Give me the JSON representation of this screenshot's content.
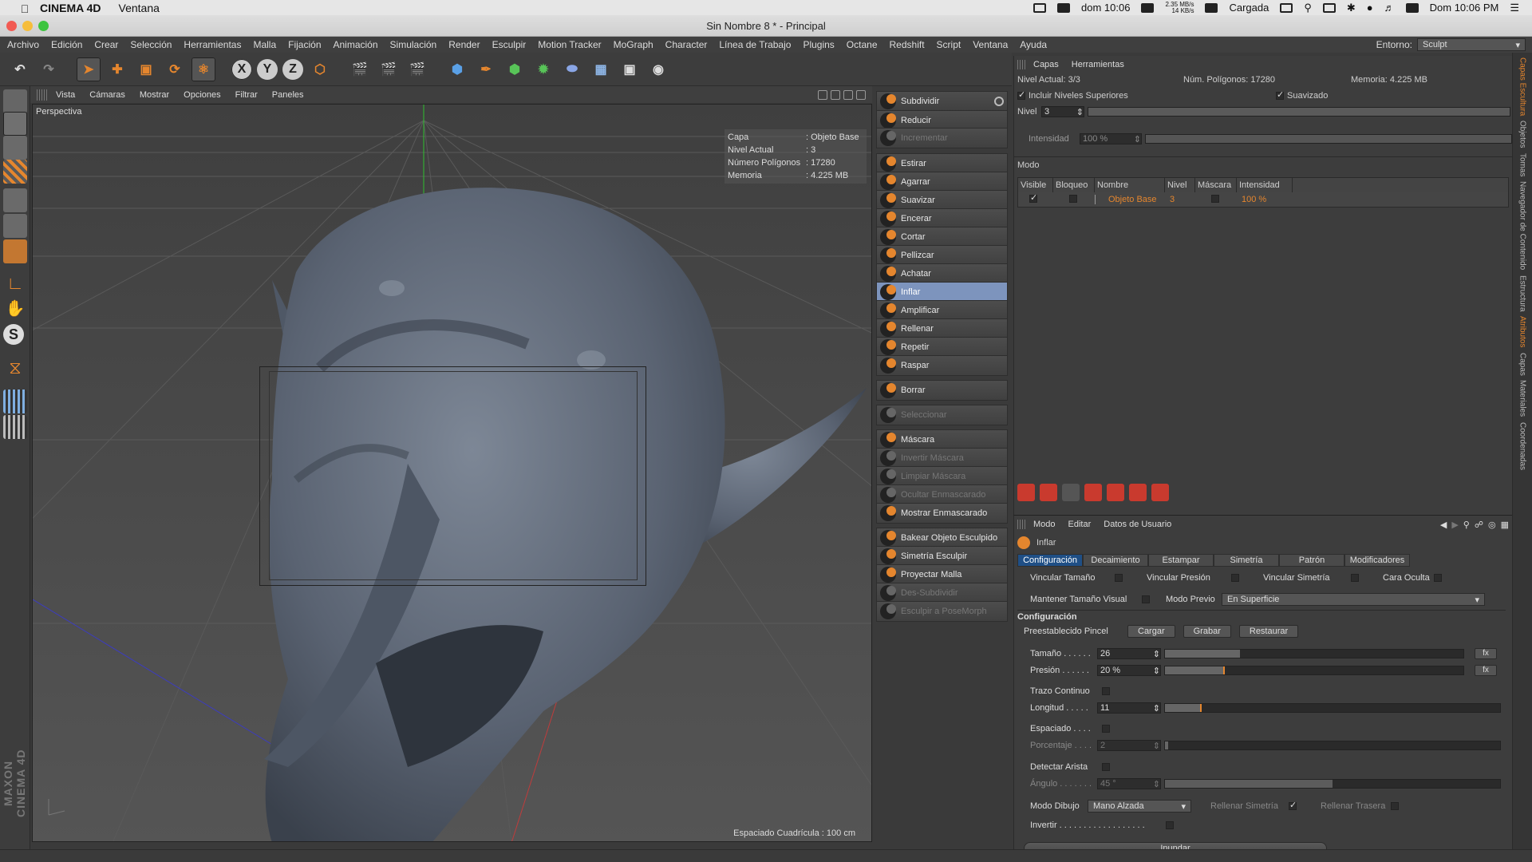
{
  "mac_menubar": {
    "app_name": "CINEMA 4D",
    "menu": "Ventana",
    "clock1": "dom 10:06",
    "net_up": "2.35 MB/s",
    "net_down": "14 KB/s",
    "battery": "Cargada",
    "clock2": "Dom 10:06 PM"
  },
  "window": {
    "title": "Sin Nombre 8 * - Principal"
  },
  "menubar": {
    "items": [
      "Archivo",
      "Edición",
      "Crear",
      "Selección",
      "Herramientas",
      "Malla",
      "Fijación",
      "Animación",
      "Simulación",
      "Render",
      "Esculpir",
      "Motion Tracker",
      "MoGraph",
      "Character",
      "Línea de Trabajo",
      "Plugins",
      "Octane",
      "Redshift",
      "Script",
      "Ventana",
      "Ayuda"
    ],
    "env_label": "Entorno:",
    "env_value": "Sculpt"
  },
  "viewport_menu": {
    "items": [
      "Vista",
      "Cámaras",
      "Mostrar",
      "Opciones",
      "Filtrar",
      "Paneles"
    ]
  },
  "viewport": {
    "label": "Perspectiva",
    "hud": [
      {
        "k": "Capa",
        "v": ": Objeto Base"
      },
      {
        "k": "Nivel Actual",
        "v": ": 3"
      },
      {
        "k": "Número Polígonos",
        "v": ": 17280"
      },
      {
        "k": "Memoria",
        "v": ": 4.225 MB"
      }
    ],
    "grid_spacing": "Espaciado Cuadrícula : 100 cm"
  },
  "sculpt_tools": [
    {
      "label": "Subdividir",
      "state": "normal"
    },
    {
      "label": "Reducir",
      "state": "normal"
    },
    {
      "label": "Incrementar",
      "state": "disabled"
    },
    {
      "label": "Estirar",
      "state": "normal"
    },
    {
      "label": "Agarrar",
      "state": "normal"
    },
    {
      "label": "Suavizar",
      "state": "normal"
    },
    {
      "label": "Encerar",
      "state": "normal"
    },
    {
      "label": "Cortar",
      "state": "normal"
    },
    {
      "label": "Pellizcar",
      "state": "normal"
    },
    {
      "label": "Achatar",
      "state": "normal"
    },
    {
      "label": "Inflar",
      "state": "active"
    },
    {
      "label": "Amplificar",
      "state": "normal"
    },
    {
      "label": "Rellenar",
      "state": "normal"
    },
    {
      "label": "Repetir",
      "state": "normal"
    },
    {
      "label": "Raspar",
      "state": "normal"
    },
    {
      "label": "Borrar",
      "state": "normal"
    },
    {
      "label": "Seleccionar",
      "state": "disabled"
    },
    {
      "label": "Máscara",
      "state": "normal"
    },
    {
      "label": "Invertir Máscara",
      "state": "disabled"
    },
    {
      "label": "Limpiar Máscara",
      "state": "disabled"
    },
    {
      "label": "Ocultar Enmascarado",
      "state": "disabled"
    },
    {
      "label": "Mostrar Enmascarado",
      "state": "normal"
    },
    {
      "label": "Bakear Objeto Esculpido",
      "state": "normal"
    },
    {
      "label": "Simetría Esculpir",
      "state": "normal"
    },
    {
      "label": "Proyectar Malla",
      "state": "normal"
    },
    {
      "label": "Des-Subdividir",
      "state": "disabled"
    },
    {
      "label": "Esculpir a PoseMorph",
      "state": "disabled"
    }
  ],
  "layers": {
    "tabs": [
      "Capas",
      "Herramientas"
    ],
    "nivel_actual": "Nivel Actual: 3/3",
    "num_poligonos": "Núm. Polígonos: 17280",
    "memoria": "Memoria: 4.225 MB",
    "incluir": "Incluir Niveles Superiores",
    "suavizado": "Suavizado",
    "nivel_label": "Nivel",
    "nivel_value": "3",
    "intensidad_label": "Intensidad",
    "intensidad_value": "100 %",
    "modo": "Modo",
    "columns": [
      "Visible",
      "Bloqueo",
      "Nombre",
      "Nivel",
      "Máscara",
      "Intensidad"
    ],
    "row": {
      "nombre": "Objeto Base",
      "nivel": "3",
      "intensidad": "100 %"
    }
  },
  "attrs": {
    "tabs": [
      "Modo",
      "Editar",
      "Datos de Usuario"
    ],
    "tool_name": "Inflar",
    "subtabs": [
      "Configuración",
      "Decaimiento",
      "Estampar",
      "Simetría",
      "Patrón",
      "Modificadores"
    ],
    "vincular_tamano": "Vincular Tamaño",
    "vincular_presion": "Vincular Presión",
    "vincular_simetria": "Vincular Simetría",
    "cara_oculta": "Cara Oculta",
    "mantener": "Mantener Tamaño Visual",
    "modo_previo_label": "Modo Previo",
    "modo_previo_value": "En Superficie",
    "section": "Configuración",
    "preset_label": "Preestablecido Pincel",
    "btn_cargar": "Cargar",
    "btn_grabar": "Grabar",
    "btn_restaurar": "Restaurar",
    "tamano_label": "Tamaño . . . . . .",
    "tamano_value": "26",
    "tamano_level": 0.25,
    "presion_label": "Presión . . . . . .",
    "presion_value": "20 %",
    "presion_level": 0.2,
    "trazo": "Trazo Continuo",
    "longitud_label": "Longitud . . . . .",
    "longitud_value": "11",
    "longitud_level": 0.11,
    "espaciado": "Espaciado . . . .",
    "porcentaje_label": "Porcentaje . . . .",
    "porcentaje_value": "2",
    "detectar": "Detectar Arista",
    "angulo_label": "Ángulo . . . . . . .",
    "angulo_value": "45 °",
    "modo_dibujo_label": "Modo Dibujo",
    "modo_dibujo_value": "Mano Alzada",
    "rellenar_simetria": "Rellenar Simetría",
    "rellenar_trasera": "Rellenar Trasera",
    "invertir": "Invertir . . . . . . . . . . . . . . . . . .",
    "inundar": "Inundar",
    "fx": "fx"
  },
  "right_strip": [
    "Capas Escultura",
    "Objetos",
    "Tomas",
    "Navegador de Contenido",
    "Estructura",
    "Atributos",
    "Capas",
    "Materiales",
    "Coordenadas"
  ],
  "logo": "MAXON CINEMA 4D",
  "colors": {
    "accent": "#e5862e",
    "active_tool": "#7d94bd",
    "active_tab": "#1f4f86",
    "layer_name": "#e5862e"
  }
}
